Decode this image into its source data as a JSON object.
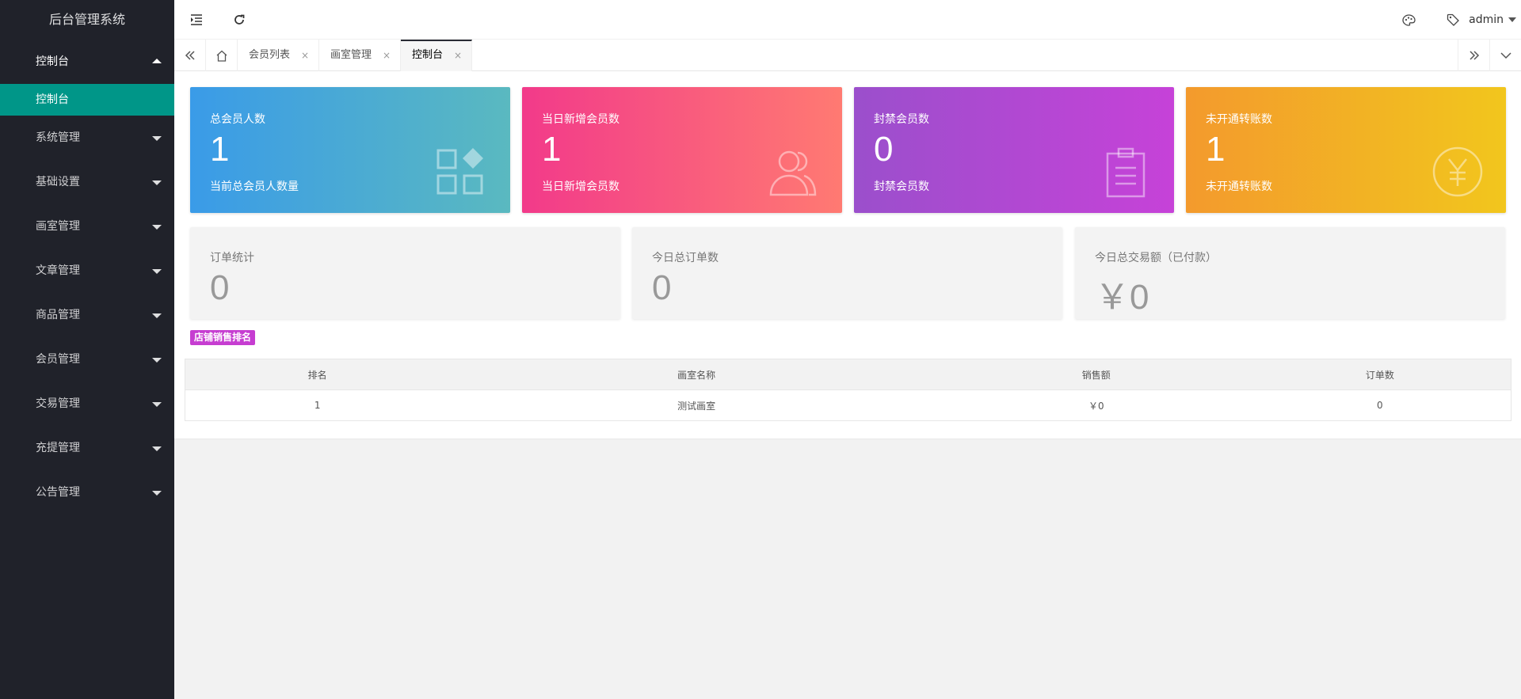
{
  "app": {
    "title": "后台管理系统"
  },
  "sidebar": {
    "items": [
      {
        "label": "控制台",
        "open": true,
        "sub": [
          {
            "label": "控制台"
          }
        ]
      },
      {
        "label": "系统管理"
      },
      {
        "label": "基础设置"
      },
      {
        "label": "画室管理"
      },
      {
        "label": "文章管理"
      },
      {
        "label": "商品管理"
      },
      {
        "label": "会员管理"
      },
      {
        "label": "交易管理"
      },
      {
        "label": "充提管理"
      },
      {
        "label": "公告管理"
      }
    ]
  },
  "header": {
    "icons": [
      "menu-fold-icon",
      "refresh-icon",
      "theme-palette-icon",
      "tag-icon"
    ],
    "user": "admin"
  },
  "tabs": {
    "items": [
      {
        "label": "会员列表",
        "close": "×"
      },
      {
        "label": "画室管理",
        "close": "×"
      },
      {
        "label": "控制台",
        "close": "×",
        "active": true
      }
    ]
  },
  "cards": [
    {
      "label": "总会员人数",
      "value": "1",
      "sub": "当前总会员人数量",
      "icon": "apps-icon",
      "gradient": [
        "#3a9be8",
        "#5ab9c0"
      ]
    },
    {
      "label": "当日新增会员数",
      "value": "1",
      "sub": "当日新增会员数",
      "icon": "users-icon",
      "gradient": [
        "#f23a8a",
        "#ff7a72"
      ]
    },
    {
      "label": "封禁会员数",
      "value": "0",
      "sub": "封禁会员数",
      "icon": "clipboard-icon",
      "gradient": [
        "#9b4fcc",
        "#c642d8"
      ]
    },
    {
      "label": "未开通转账数",
      "value": "1",
      "sub": "未开通转账数",
      "icon": "yen-icon",
      "gradient": [
        "#f39a2d",
        "#f2c61d"
      ]
    }
  ],
  "stats": [
    {
      "label": "订单统计",
      "value": "0"
    },
    {
      "label": "今日总订单数",
      "value": "0"
    },
    {
      "label": "今日总交易额（已付款）",
      "value": "￥0"
    }
  ],
  "ranking": {
    "title": "店铺销售排名",
    "columns": [
      "排名",
      "画室名称",
      "销售额",
      "订单数"
    ],
    "rows": [
      [
        "1",
        "测试画室",
        "￥0",
        "0"
      ]
    ]
  }
}
